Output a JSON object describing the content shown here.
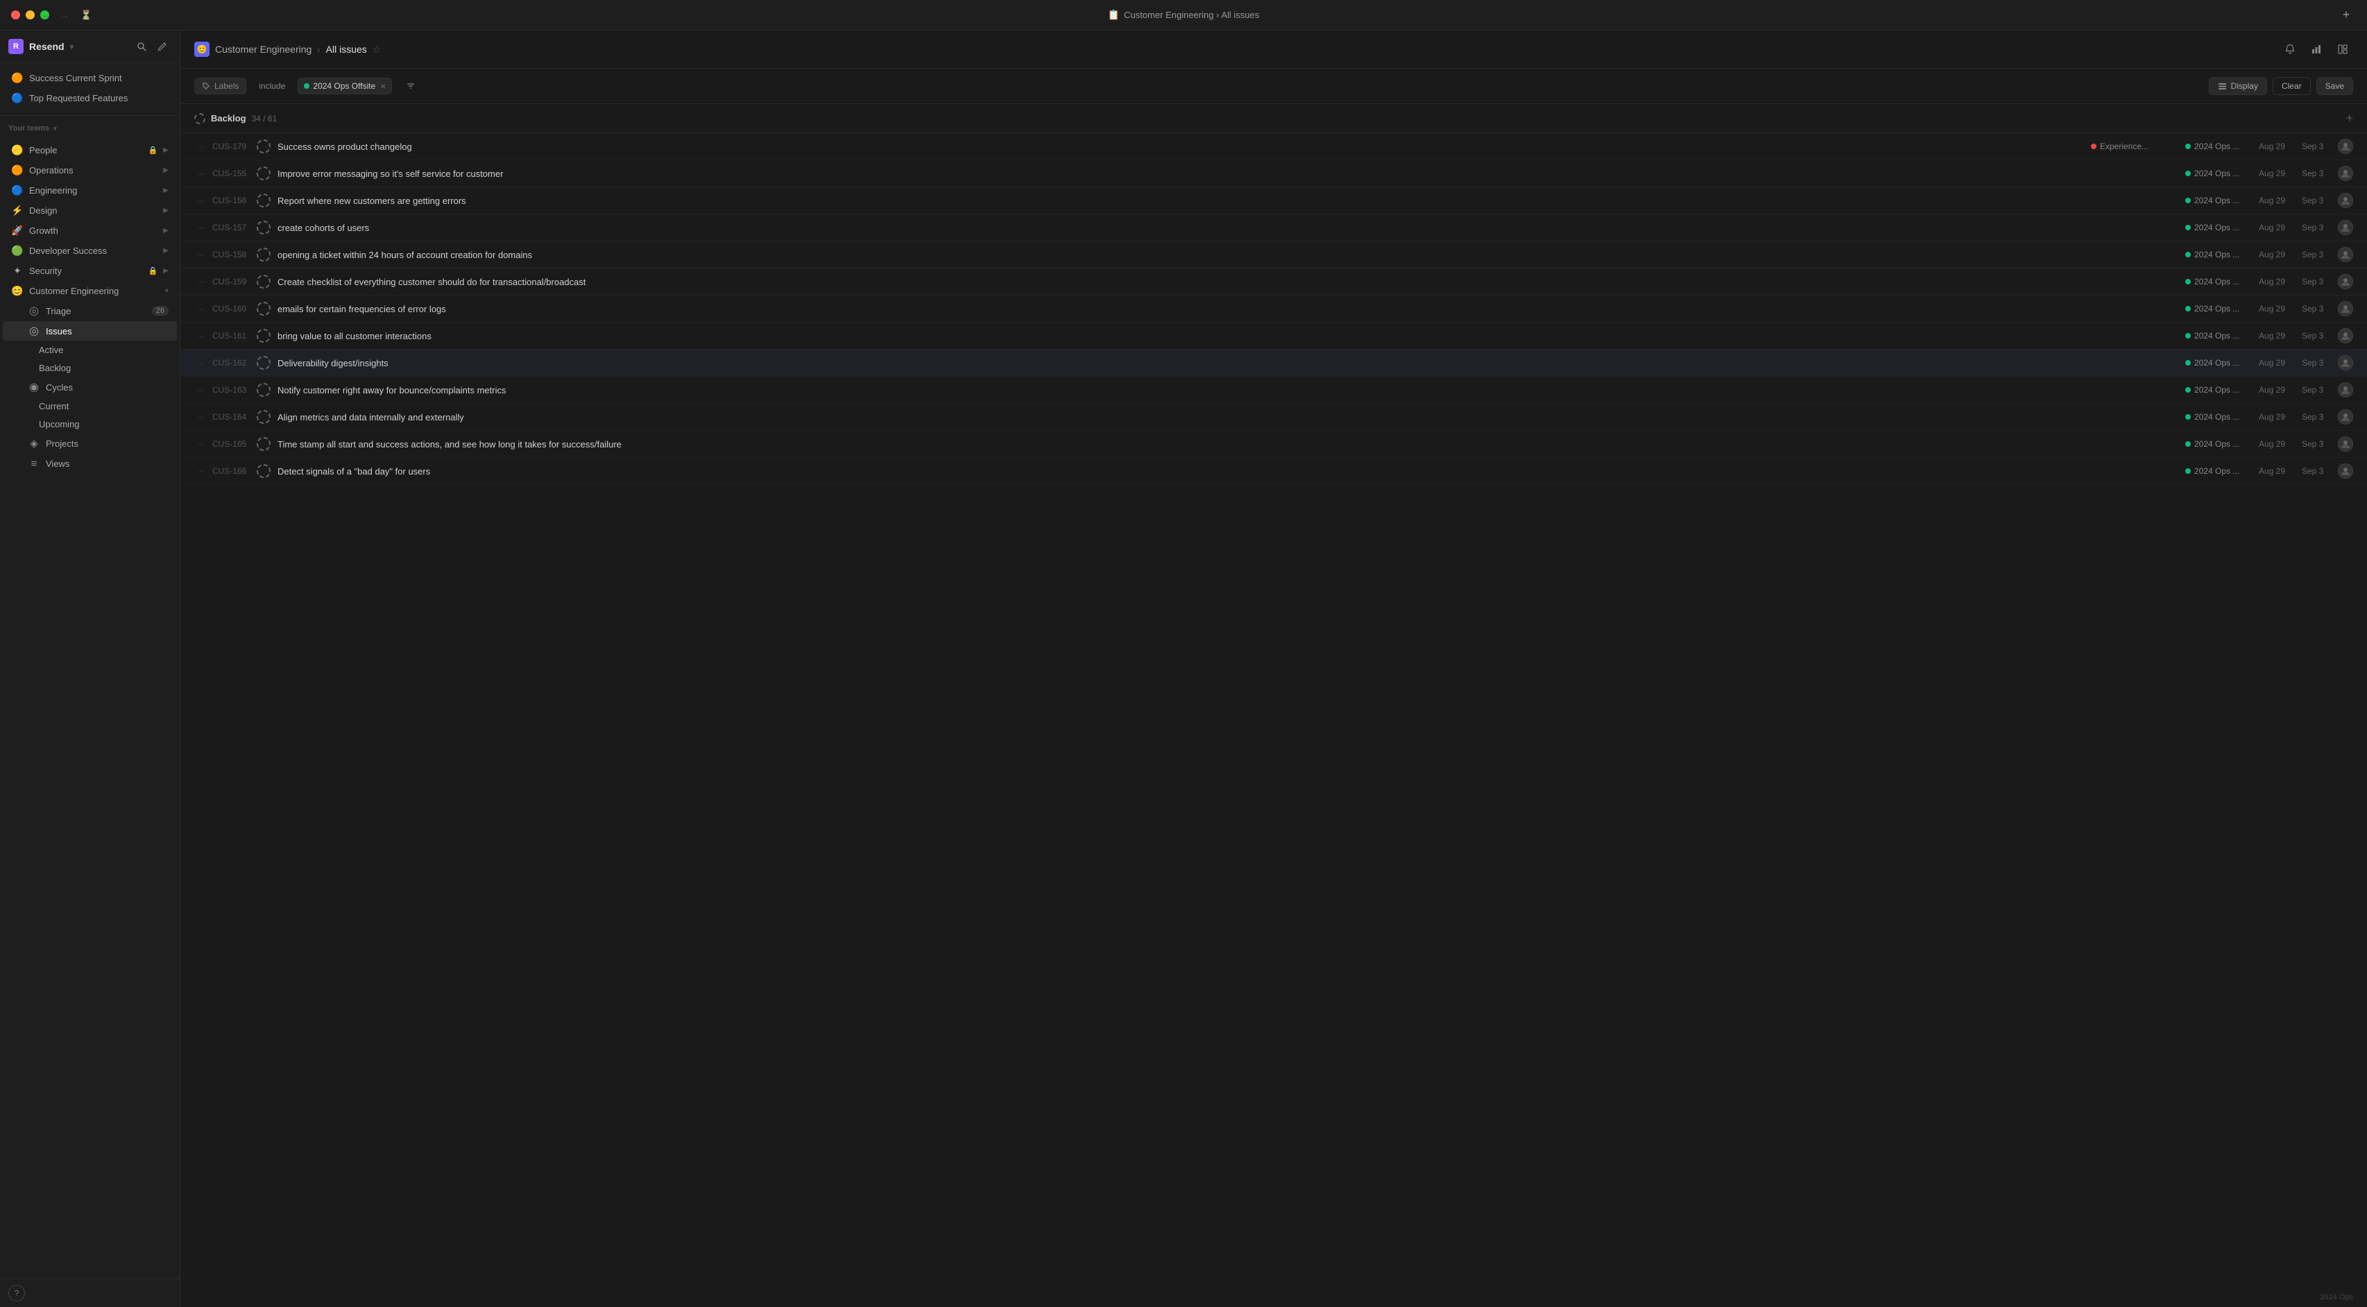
{
  "app": {
    "title": "Customer Engineering › All issues",
    "brand": "Resend",
    "brand_initial": "R"
  },
  "titlebar": {
    "back_label": "←",
    "forward_label": "→",
    "history_label": "⏱",
    "title": "Customer Engineering › All issues",
    "add_label": "+"
  },
  "sidebar": {
    "header": {
      "brand": "Resend",
      "search_icon": "search-icon",
      "edit_icon": "edit-icon"
    },
    "quick_items": [
      {
        "label": "Success Current Sprint",
        "icon": "🟠"
      },
      {
        "label": "Top Requested Features",
        "icon": "🔵"
      }
    ],
    "teams_label": "Your teams",
    "teams": [
      {
        "label": "People",
        "icon": "🟡",
        "locked": true,
        "has_children": true
      },
      {
        "label": "Operations",
        "icon": "🟠",
        "has_children": true
      },
      {
        "label": "Engineering",
        "icon": "🔵",
        "has_children": true
      },
      {
        "label": "Design",
        "icon": "⚡",
        "has_children": true
      },
      {
        "label": "Growth",
        "icon": "🚀",
        "has_children": true
      },
      {
        "label": "Developer Success",
        "icon": "🟢",
        "has_children": true
      },
      {
        "label": "Security",
        "icon": "✦",
        "locked": true,
        "has_children": true
      },
      {
        "label": "Customer Engineering",
        "icon": "😊",
        "has_children": true,
        "expanded": true
      }
    ],
    "customer_eng_items": [
      {
        "label": "Triage",
        "icon": "◎",
        "badge": "26",
        "sub": true
      },
      {
        "label": "Issues",
        "icon": "◎",
        "sub": true,
        "active": true
      },
      {
        "label": "Active",
        "icon": "",
        "sub2": true
      },
      {
        "label": "Backlog",
        "icon": "",
        "sub2": true
      },
      {
        "label": "Cycles",
        "icon": "◉",
        "sub": true
      },
      {
        "label": "Current",
        "icon": "",
        "sub2": true
      },
      {
        "label": "Upcoming",
        "icon": "",
        "sub2": true
      },
      {
        "label": "Projects",
        "icon": "◈",
        "sub": true
      },
      {
        "label": "Views",
        "icon": "≡",
        "sub": true
      }
    ],
    "help_label": "?"
  },
  "main": {
    "breadcrumb_icon": "📋",
    "breadcrumb_team": "Customer Engineering",
    "breadcrumb_separator": "›",
    "breadcrumb_page": "All issues",
    "header_icons": [
      "bell-icon",
      "bar-chart-icon",
      "layout-icon"
    ],
    "filter": {
      "labels_label": "Labels",
      "include_label": "include",
      "tag_label": "2024 Ops Offsite",
      "tag_dot_color": "#10b981",
      "display_label": "Display",
      "clear_label": "Clear",
      "save_label": "Save"
    },
    "backlog": {
      "title": "Backlog",
      "count": "34 / 61",
      "add_label": "+"
    },
    "issues": [
      {
        "id": "CUS-179",
        "title": "Success owns product changelog",
        "label": "Experience...",
        "label_dot": "#ef4444",
        "cycle": "2024 Ops ...",
        "cycle_dot": "#10b981",
        "date1": "Aug 29",
        "date2": "Sep 3",
        "has_avatar": true
      },
      {
        "id": "CUS-155",
        "title": "Improve error messaging so it's self service for customer",
        "label": "",
        "cycle": "2024 Ops ...",
        "cycle_dot": "#10b981",
        "date1": "Aug 29",
        "date2": "Sep 3",
        "has_avatar": true
      },
      {
        "id": "CUS-156",
        "title": "Report where new customers are getting errors",
        "label": "",
        "cycle": "2024 Ops ...",
        "cycle_dot": "#10b981",
        "date1": "Aug 29",
        "date2": "Sep 3",
        "has_avatar": true
      },
      {
        "id": "CUS-157",
        "title": "create cohorts of users",
        "label": "",
        "cycle": "2024 Ops ...",
        "cycle_dot": "#10b981",
        "date1": "Aug 29",
        "date2": "Sep 3",
        "has_avatar": true
      },
      {
        "id": "CUS-158",
        "title": "opening a ticket within 24 hours of account creation for domains",
        "label": "",
        "cycle": "2024 Ops ...",
        "cycle_dot": "#10b981",
        "date1": "Aug 29",
        "date2": "Sep 3",
        "has_avatar": true
      },
      {
        "id": "CUS-159",
        "title": "Create checklist of everything customer should do for transactional/broadcast",
        "label": "",
        "cycle": "2024 Ops ...",
        "cycle_dot": "#10b981",
        "date1": "Aug 29",
        "date2": "Sep 3",
        "has_avatar": true
      },
      {
        "id": "CUS-160",
        "title": "emails for certain frequencies of error logs",
        "label": "",
        "cycle": "2024 Ops ...",
        "cycle_dot": "#10b981",
        "date1": "Aug 29",
        "date2": "Sep 3",
        "has_avatar": true
      },
      {
        "id": "CUS-161",
        "title": "bring value to all customer interactions",
        "label": "",
        "cycle": "2024 Ops ...",
        "cycle_dot": "#10b981",
        "date1": "Aug 29",
        "date2": "Sep 3",
        "has_avatar": true
      },
      {
        "id": "CUS-162",
        "title": "Deliverability digest/insights",
        "label": "",
        "cycle": "2024 Ops ...",
        "cycle_dot": "#10b981",
        "date1": "Aug 29",
        "date2": "Sep 3",
        "has_avatar": true,
        "highlighted": true
      },
      {
        "id": "CUS-163",
        "title": "Notify customer right away for bounce/complaints metrics",
        "label": "",
        "cycle": "2024 Ops ...",
        "cycle_dot": "#10b981",
        "date1": "Aug 29",
        "date2": "Sep 3",
        "has_avatar": true
      },
      {
        "id": "CUS-164",
        "title": "Align metrics and data internally and externally",
        "label": "",
        "cycle": "2024 Ops ...",
        "cycle_dot": "#10b981",
        "date1": "Aug 29",
        "date2": "Sep 3",
        "has_avatar": true
      },
      {
        "id": "CUS-165",
        "title": "Time stamp all start and success actions, and see how long it takes for success/failure",
        "label": "",
        "cycle": "2024 Ops ...",
        "cycle_dot": "#10b981",
        "date1": "Aug 29",
        "date2": "Sep 3",
        "has_avatar": true
      },
      {
        "id": "CUS-166",
        "title": "Detect signals of a \"bad day\" for users",
        "label": "",
        "cycle": "2024 Ops ...",
        "cycle_dot": "#10b981",
        "date1": "Aug 29",
        "date2": "Sep 3",
        "has_avatar": true
      }
    ]
  },
  "watermark": {
    "text": "2024 Ops"
  }
}
